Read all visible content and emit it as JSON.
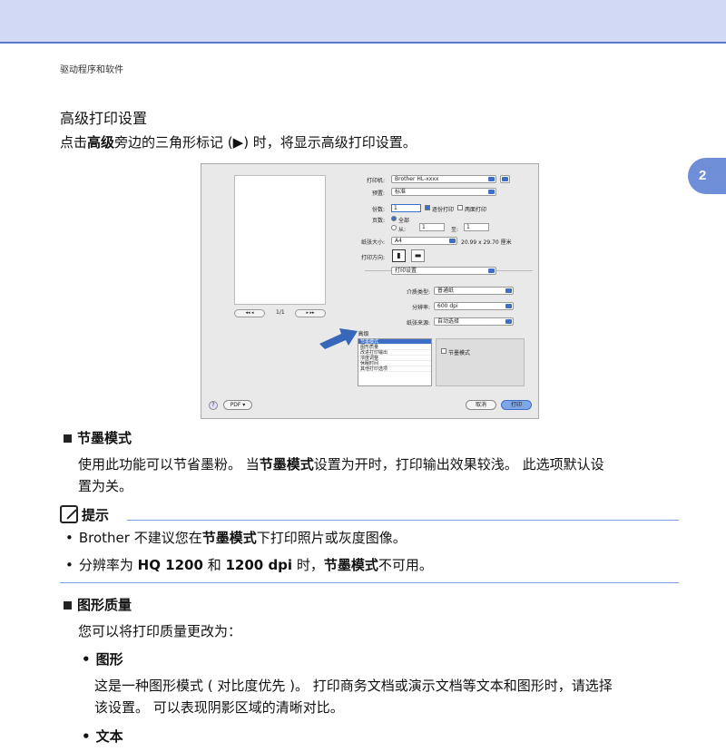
{
  "header": {
    "crumb": "驱动程序和软件",
    "chapter": "2"
  },
  "section": {
    "title": "高级打印设置",
    "intro_pre": "点击",
    "intro_bold": "高级",
    "intro_post": "旁边的三角形标记 (▶) 时，将显示高级打印设置。"
  },
  "dialog": {
    "page_indicator": "1/1",
    "printer_label": "打印机:",
    "printer_value": "Brother HL-xxxx",
    "presets_label": "预置:",
    "presets_value": "标准",
    "copies_label": "份数:",
    "copies_value": "1",
    "collate_label": "逐份打印",
    "duplex_label": "两面打印",
    "pages_label": "页数:",
    "pages_all": "全部",
    "pages_from": "从:",
    "from_value": "1",
    "pages_to": "至:",
    "to_value": "1",
    "paper_label": "纸张大小:",
    "paper_value": "A4",
    "paper_dims": "20.99 x 29.70 厘米",
    "orient_label": "打印方向:",
    "panel_value": "打印设置",
    "media_label": "介质类型:",
    "media_value": "普通纸",
    "resolution_label": "分辨率:",
    "resolution_value": "600 dpi",
    "source_label": "纸张来源:",
    "source_value": "自动选择",
    "advanced_label": "▼ 高级",
    "list_items": [
      "节墨模式",
      "图形质量",
      "改进打印输出",
      "浓度调整",
      "休眠时间",
      "其他打印选项"
    ],
    "toner_option": "节墨模式",
    "pdf_button": "PDF ▾",
    "cancel_button": "取消",
    "print_button": "打印",
    "help_glyph": "?"
  },
  "toner_save": {
    "title": "节墨模式",
    "p1": "使用此功能可以节省墨粉。 当",
    "p1_bold": "节墨模式",
    "p1_post": "设置为开时，打印输出效果较浅。 此选项默认设",
    "p2": "置为关。"
  },
  "note": {
    "title": "提示",
    "item1_pre": "Brother 不建议您在",
    "item1_bold": "节墨模式",
    "item1_post": "下打印照片或灰度图像。",
    "item2_pre": "分辨率为 ",
    "item2_b1": "HQ 1200",
    "item2_mid": " 和 ",
    "item2_b2": "1200 dpi",
    "item2_mid2": " 时，",
    "item2_b3": "节墨模式",
    "item2_post": "不可用。"
  },
  "graphics_quality": {
    "title": "图形质量",
    "intro": "您可以将打印质量更改为：",
    "opt1_title": "图形",
    "opt1_l1": "这是一种图形模式 ( 对比度优先 )。 打印商务文档或演示文档等文本和图形时，请选择",
    "opt1_l2": "该设置。 可以表现阴影区域的清晰对比。",
    "opt2_title": "文本"
  }
}
